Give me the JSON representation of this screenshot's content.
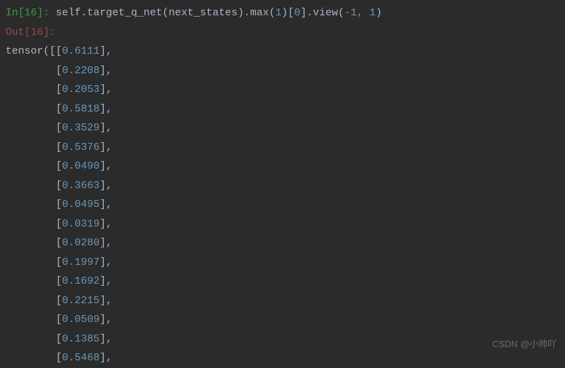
{
  "prompt": {
    "in_label": "In[16]:",
    "out_label": "Out[16]:"
  },
  "code": {
    "prefix": " self.target_q_net(next_states).max(",
    "arg1": "1",
    "mid1": ")[",
    "arg2": "0",
    "mid2": "].view(",
    "arg3": "-1",
    "comma": ",",
    "space": " ",
    "arg4": "1",
    "suffix": ")"
  },
  "output": {
    "tensor_open": "tensor([[",
    "row_open": "        [",
    "row_close": "],",
    "first_close": "],",
    "values": [
      "0.6111",
      "0.2208",
      "0.2053",
      "0.5818",
      "0.3529",
      "0.5376",
      "0.0490",
      "0.3663",
      "0.0495",
      "0.0319",
      "0.0280",
      "0.1997",
      "0.1692",
      "0.2215",
      "0.0509",
      "0.1385",
      "0.5468"
    ]
  },
  "watermark": "CSDN @小帅吖"
}
